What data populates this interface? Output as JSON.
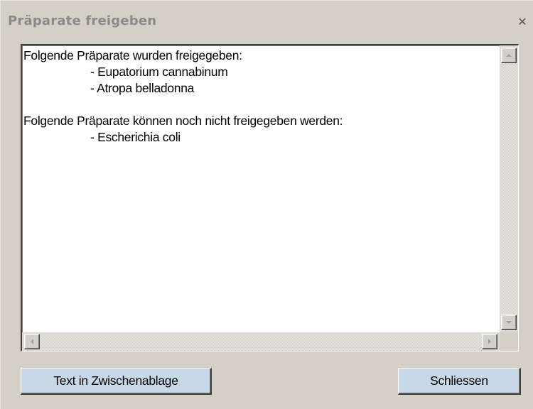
{
  "window": {
    "title": "Präparate freigeben",
    "close_glyph": "✕"
  },
  "textbox": {
    "lines": [
      {
        "text": "Folgende Präparate wurden freigegeben:",
        "indent": false
      },
      {
        "text": "- Eupatorium cannabinum",
        "indent": true
      },
      {
        "text": "- Atropa belladonna",
        "indent": true
      },
      {
        "text": "",
        "indent": false
      },
      {
        "text": "Folgende Präparate können noch nicht freigegeben werden:",
        "indent": false
      },
      {
        "text": "- Escherichia coli",
        "indent": true
      }
    ]
  },
  "buttons": {
    "copy_label": "Text in Zwischenablage",
    "close_label": "Schliessen"
  },
  "colors": {
    "button_bg": "#c9d8e6",
    "title_text": "#8a8a8a",
    "window_bg": "#d4d0c8"
  }
}
